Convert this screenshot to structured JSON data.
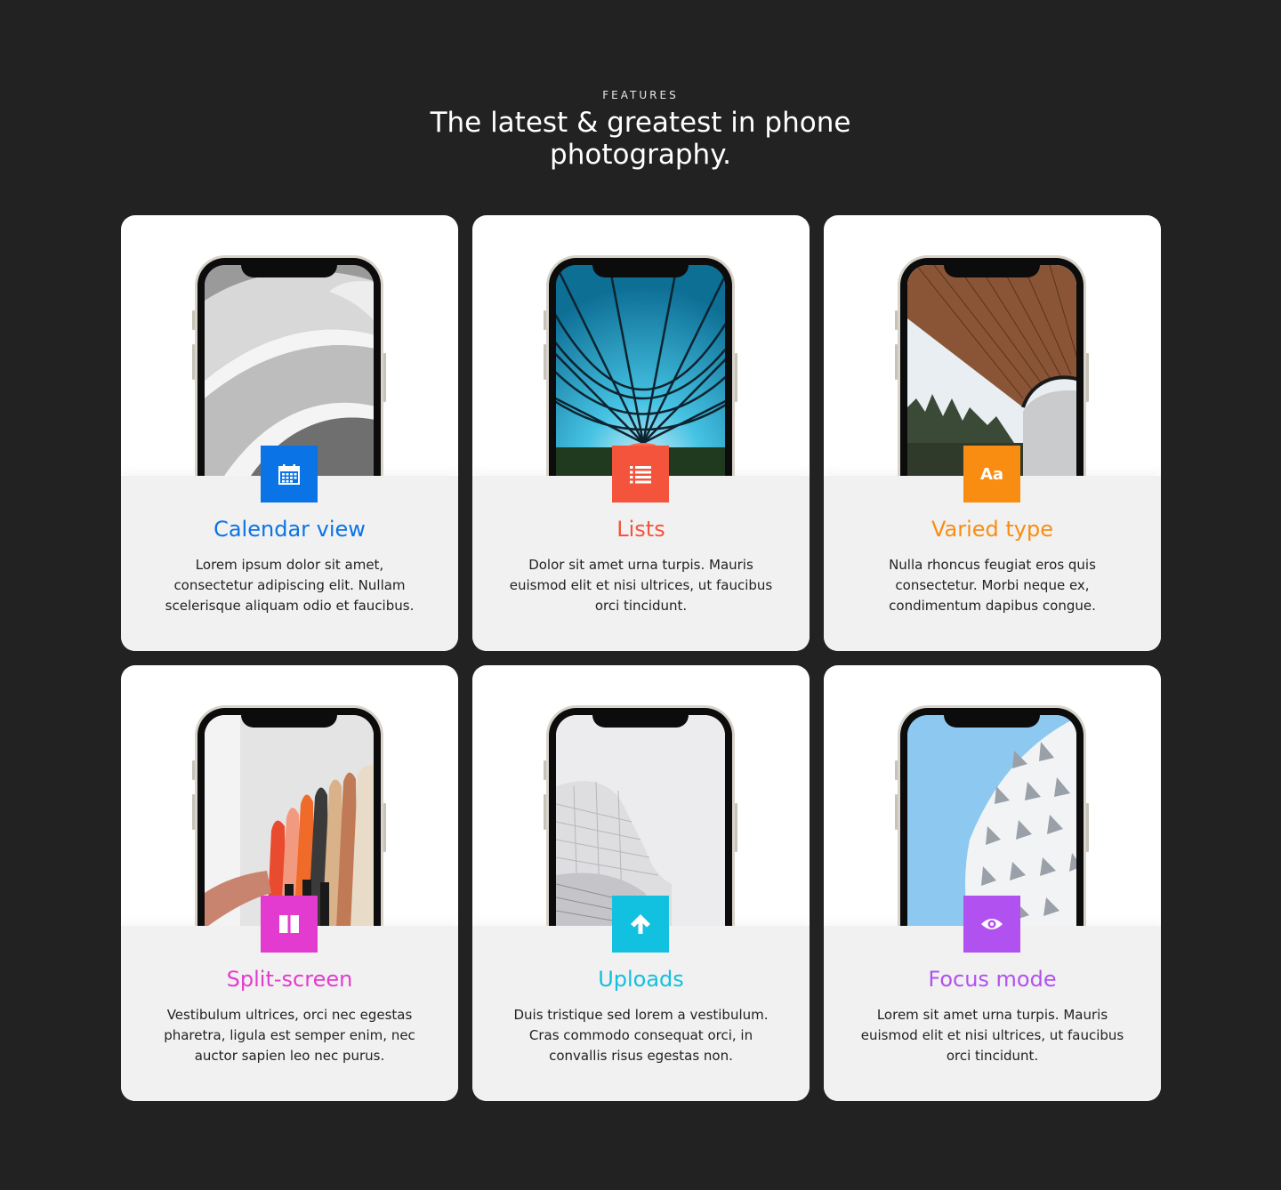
{
  "header": {
    "eyebrow": "FEATURES",
    "title": "The latest & greatest in phone photography."
  },
  "features": [
    {
      "title": "Calendar view",
      "description": "Lorem ipsum dolor sit amet, consectetur adipiscing elit. Nullam scelerisque aliquam odio et faucibus.",
      "color": "#0a74e6",
      "icon": "calendar-icon"
    },
    {
      "title": "Lists",
      "description": "Dolor sit amet urna turpis. Mauris euismod elit et nisi ultrices, ut faucibus orci tincidunt.",
      "color": "#f4533c",
      "icon": "list-icon"
    },
    {
      "title": "Varied type",
      "description": "Nulla rhoncus feugiat eros quis consectetur. Morbi neque ex, condimentum dapibus congue.",
      "color": "#f98d11",
      "icon": "Aa"
    },
    {
      "title": "Split-screen",
      "description": "Vestibulum ultrices, orci nec egestas pharetra, ligula est semper enim, nec auctor sapien leo nec purus.",
      "color": "#e33bcf",
      "icon": "split-screen-icon"
    },
    {
      "title": "Uploads",
      "description": "Duis tristique sed lorem a vestibulum. Cras commodo consequat orci, in convallis risus egestas non.",
      "color": "#12c0df",
      "icon": "upload-arrow-icon"
    },
    {
      "title": "Focus mode",
      "description": "Lorem sit amet urna turpis. Mauris euismod elit et nisi ultrices, ut faucibus orci tincidunt.",
      "color": "#b152f0",
      "icon": "eye-icon"
    }
  ]
}
